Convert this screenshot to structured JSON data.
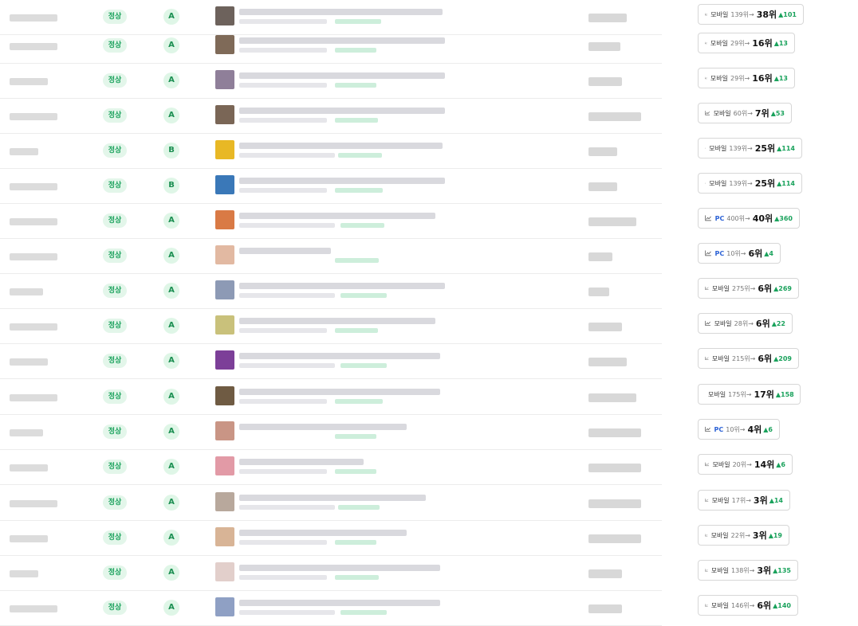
{
  "table": {
    "rows": [
      {
        "status": "정상",
        "grade": "A",
        "device": "모바일",
        "prev": "139위→",
        "current": "38위",
        "change": "▲101",
        "thumb": "#6d625c"
      },
      {
        "status": "정상",
        "grade": "A",
        "device": "모바일",
        "prev": "29위→",
        "current": "16위",
        "change": "▲13",
        "thumb": "#7f6a58"
      },
      {
        "status": "정상",
        "grade": "A",
        "device": "모바일",
        "prev": "29위→",
        "current": "16위",
        "change": "▲13",
        "thumb": "#8f7f99"
      },
      {
        "status": "정상",
        "grade": "A",
        "device": "모바일",
        "prev": "60위→",
        "current": "7위",
        "change": "▲53",
        "thumb": "#7a6656"
      },
      {
        "status": "정상",
        "grade": "B",
        "device": "모바일",
        "prev": "139위→",
        "current": "25위",
        "change": "▲114",
        "thumb": "#e8b825"
      },
      {
        "status": "정상",
        "grade": "B",
        "device": "모바일",
        "prev": "139위→",
        "current": "25위",
        "change": "▲114",
        "thumb": "#3a78b8"
      },
      {
        "status": "정상",
        "grade": "A",
        "device": "PC",
        "prev": "400위→",
        "current": "40위",
        "change": "▲360",
        "thumb": "#d97a45"
      },
      {
        "status": "정상",
        "grade": "A",
        "device": "PC",
        "prev": "10위→",
        "current": "6위",
        "change": "▲4",
        "thumb": "#e2b9a2"
      },
      {
        "status": "정상",
        "grade": "A",
        "device": "모바일",
        "prev": "275위→",
        "current": "6위",
        "change": "▲269",
        "thumb": "#8d9ab5"
      },
      {
        "status": "정상",
        "grade": "A",
        "device": "모바일",
        "prev": "28위→",
        "current": "6위",
        "change": "▲22",
        "thumb": "#c9c17b"
      },
      {
        "status": "정상",
        "grade": "A",
        "device": "모바일",
        "prev": "215위→",
        "current": "6위",
        "change": "▲209",
        "thumb": "#7c3f98"
      },
      {
        "status": "정상",
        "grade": "A",
        "device": "모바일",
        "prev": "175위→",
        "current": "17위",
        "change": "▲158",
        "thumb": "#6f5b43"
      },
      {
        "status": "정상",
        "grade": "A",
        "device": "PC",
        "prev": "10위→",
        "current": "4위",
        "change": "▲6",
        "thumb": "#c99585"
      },
      {
        "status": "정상",
        "grade": "A",
        "device": "모바일",
        "prev": "20위→",
        "current": "14위",
        "change": "▲6",
        "thumb": "#e29aa6"
      },
      {
        "status": "정상",
        "grade": "A",
        "device": "모바일",
        "prev": "17위→",
        "current": "3위",
        "change": "▲14",
        "thumb": "#b8a89c"
      },
      {
        "status": "정상",
        "grade": "A",
        "device": "모바일",
        "prev": "22위→",
        "current": "3위",
        "change": "▲19",
        "thumb": "#d8b496"
      },
      {
        "status": "정상",
        "grade": "A",
        "device": "모바일",
        "prev": "138위→",
        "current": "3위",
        "change": "▲135",
        "thumb": "#e2cfcb"
      },
      {
        "status": "정상",
        "grade": "A",
        "device": "모바일",
        "prev": "146위→",
        "current": "6위",
        "change": "▲140",
        "thumb": "#8fa0c4"
      }
    ]
  },
  "colors": {
    "status_bg": "#e3f6ea",
    "status_text": "#1aa25c",
    "grade_bg": "#dff6e7",
    "pc_blue": "#2d63d6",
    "up_green": "#1aa25c"
  },
  "icons": {
    "rank_button": "line-chart-icon"
  }
}
